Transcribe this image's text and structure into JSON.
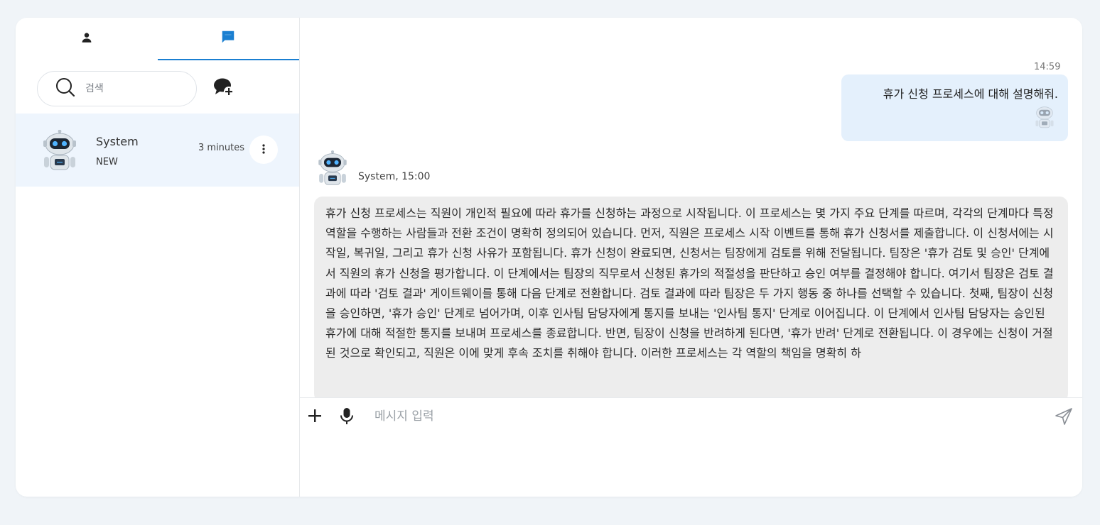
{
  "sidebar": {
    "tabs": [
      {
        "name": "contacts",
        "icon": "user-icon"
      },
      {
        "name": "chats",
        "icon": "chat-icon",
        "active": true
      }
    ],
    "search": {
      "placeholder": "검색",
      "icon": "search-icon"
    },
    "new_chat_icon": "new-chat-icon",
    "conversations": [
      {
        "name": "System",
        "tag": "NEW",
        "time": "3 minutes",
        "avatar": "robot-avatar",
        "selected": true
      }
    ]
  },
  "chat": {
    "messages": [
      {
        "role": "user",
        "time": "14:59",
        "text": "휴가 신청 프로세스에 대해 설명해줘."
      },
      {
        "role": "system",
        "meta": "System, 15:00",
        "text": "휴가 신청 프로세스는 직원이 개인적 필요에 따라 휴가를 신청하는 과정으로 시작됩니다. 이 프로세스는 몇 가지 주요 단계를 따르며, 각각의 단계마다 특정 역할을 수행하는 사람들과 전환 조건이 명확히 정의되어 있습니다. 먼저, 직원은 프로세스 시작 이벤트를 통해 휴가 신청서를 제출합니다. 이 신청서에는 시작일, 복귀일, 그리고 휴가 신청 사유가 포함됩니다. 휴가 신청이 완료되면, 신청서는 팀장에게 검토를 위해 전달됩니다. 팀장은 '휴가 검토 및 승인' 단계에서 직원의 휴가 신청을 평가합니다. 이 단계에서는 팀장의 직무로서 신청된 휴가의 적절성을 판단하고 승인 여부를 결정해야 합니다. 여기서 팀장은 검토 결과에 따라 '검토 결과' 게이트웨이를 통해 다음 단계로 전환합니다. 검토 결과에 따라 팀장은 두 가지 행동 중 하나를 선택할 수 있습니다. 첫째, 팀장이 신청을 승인하면, '휴가 승인' 단계로 넘어가며, 이후 인사팀 담당자에게 통지를 보내는 '인사팀 통지' 단계로 이어집니다. 이 단계에서 인사팀 담당자는 승인된 휴가에 대해 적절한 통지를 보내며 프로세스를 종료합니다. 반면, 팀장이 신청을 반려하게 된다면, '휴가 반려' 단계로 전환됩니다. 이 경우에는 신청이 거절된 것으로 확인되고, 직원은 이에 맞게 후속 조치를 취해야 합니다. 이러한 프로세스는 각 역할의 책임을 명확히 하"
      }
    ],
    "composer": {
      "placeholder": "메시지 입력"
    }
  },
  "colors": {
    "accent": "#1a7fd1",
    "user_bubble": "#e4f0fc",
    "system_bubble": "#ededed",
    "selected_row": "#eef5fd",
    "page_bg": "#f0f4f8"
  }
}
